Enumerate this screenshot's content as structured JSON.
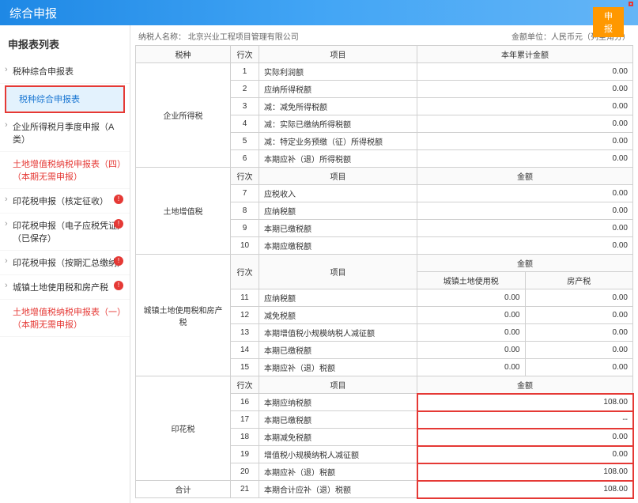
{
  "header": {
    "title": "综合申报",
    "submit_btn": "申报"
  },
  "sidebar": {
    "title": "申报表列表",
    "group_label": "税种综合申报表",
    "items": [
      {
        "label": "税种综合申报表",
        "selected": true
      },
      {
        "label": "企业所得税月季度申报（A类）"
      },
      {
        "label": "土地增值税纳税申报表（四）（本期无需申报）",
        "red": true
      },
      {
        "label": "印花税申报（核定征收）",
        "badge": "!"
      },
      {
        "label": "印花税申报（电子应税凭证）（已保存）",
        "badge": "!"
      },
      {
        "label": "印花税申报（按期汇总缴纳）",
        "badge": "!"
      },
      {
        "label": "城镇土地使用税和房产税",
        "badge": "!"
      },
      {
        "label": "土地增值税纳税申报表（一）（本期无需申报）",
        "red": true
      }
    ]
  },
  "top_info": {
    "org": "纳税人名称：  北京兴业工程项目管理有限公司",
    "unit": "金额单位：人民币元（列至角分）"
  },
  "headers": {
    "taxtype": "税种",
    "rownum": "行次",
    "item": "项目",
    "year_amt": "本年累计金额",
    "amount": "金额",
    "city_tax": "城镇土地使用税",
    "prop_tax": "房产税"
  },
  "sections": {
    "s1": {
      "name": "企业所得税",
      "rows": [
        {
          "n": "1",
          "item": "实际利润额",
          "v": "0.00"
        },
        {
          "n": "2",
          "item": "应纳所得税额",
          "v": "0.00"
        },
        {
          "n": "3",
          "item": "减：减免所得税额",
          "v": "0.00"
        },
        {
          "n": "4",
          "item": "减：实际已缴纳所得税额",
          "v": "0.00"
        },
        {
          "n": "5",
          "item": "减：特定业务预缴（征）所得税额",
          "v": "0.00"
        },
        {
          "n": "6",
          "item": "本期应补（退）所得税额",
          "v": "0.00"
        }
      ]
    },
    "s2": {
      "name": "土地增值税",
      "rows": [
        {
          "n": "7",
          "item": "应税收入",
          "v": "0.00"
        },
        {
          "n": "8",
          "item": "应纳税额",
          "v": "0.00"
        },
        {
          "n": "9",
          "item": "本期已缴税额",
          "v": "0.00"
        },
        {
          "n": "10",
          "item": "本期应缴税额",
          "v": "0.00"
        }
      ]
    },
    "s3": {
      "name": "城镇土地使用税和房产税",
      "rows": [
        {
          "n": "11",
          "item": "应纳税额",
          "v1": "0.00",
          "v2": "0.00"
        },
        {
          "n": "12",
          "item": "减免税额",
          "v1": "0.00",
          "v2": "0.00"
        },
        {
          "n": "13",
          "item": "本期增值税小规模纳税人减征额",
          "v1": "0.00",
          "v2": "0.00"
        },
        {
          "n": "14",
          "item": "本期已缴税额",
          "v1": "0.00",
          "v2": "0.00"
        },
        {
          "n": "15",
          "item": "本期应补（退）税额",
          "v1": "0.00",
          "v2": "0.00"
        }
      ]
    },
    "s4": {
      "name": "印花税",
      "rows": [
        {
          "n": "16",
          "item": "本期应纳税额",
          "v": "108.00",
          "hl": true
        },
        {
          "n": "17",
          "item": "本期已缴税额",
          "v": "--",
          "hl": true
        },
        {
          "n": "18",
          "item": "本期减免税额",
          "v": "0.00",
          "hl": true
        },
        {
          "n": "19",
          "item": "增值税小规模纳税人减征额",
          "v": "0.00",
          "hl": true
        },
        {
          "n": "20",
          "item": "本期应补（退）税额",
          "v": "108.00",
          "hl": true
        }
      ]
    },
    "s5": {
      "name": "合计",
      "row": {
        "n": "21",
        "item": "本期合计应补（退）税额",
        "v": "108.00",
        "hl": true
      }
    }
  }
}
